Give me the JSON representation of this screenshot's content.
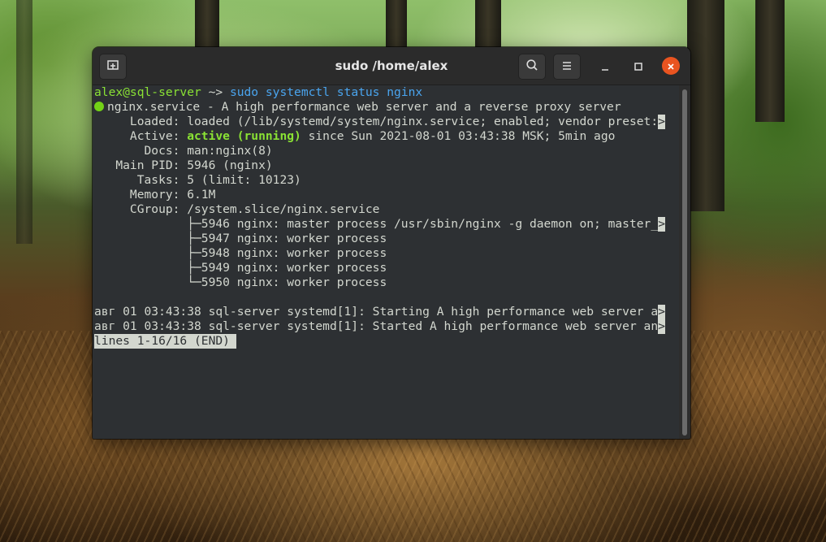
{
  "window": {
    "title": "sudo /home/alex",
    "accent_close": "#e95420",
    "new_tab_icon": "new-tab-icon",
    "search_icon": "search-icon",
    "menu_icon": "hamburger-menu-icon"
  },
  "terminal": {
    "prompt_user": "alex@sql-server",
    "prompt_dir": " ~> ",
    "command": "sudo systemctl status nginx",
    "service_line": "nginx.service - A high performance web server and a reverse proxy server",
    "loaded_key": "     Loaded: ",
    "loaded_value": "loaded (/lib/systemd/system/nginx.service; enabled; vendor preset:",
    "active_key": "     Active: ",
    "active_status": "active (running)",
    "active_rest": " since Sun 2021-08-01 03:43:38 MSK; 5min ago",
    "docs": "       Docs: man:nginx(8)",
    "main_pid": "   Main PID: 5946 (nginx)",
    "tasks": "      Tasks: 5 (limit: 10123)",
    "memory": "     Memory: 6.1M",
    "cgroup": "     CGroup: /system.slice/nginx.service",
    "proc1": "             ├─5946 nginx: master process /usr/sbin/nginx -g daemon on; master_",
    "proc2": "             ├─5947 nginx: worker process",
    "proc3": "             ├─5948 nginx: worker process",
    "proc4": "             ├─5949 nginx: worker process",
    "proc5": "             └─5950 nginx: worker process",
    "log1": "авг 01 03:43:38 sql-server systemd[1]: Starting A high performance web server a",
    "log2": "авг 01 03:43:38 sql-server systemd[1]: Started A high performance web server an",
    "trunc_marker": ">",
    "pager_status": "lines 1-16/16 (END)"
  }
}
